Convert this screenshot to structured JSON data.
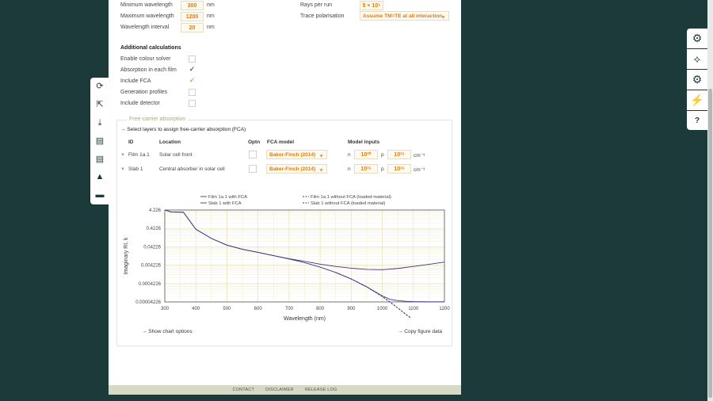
{
  "settings": {
    "min_wavelength": {
      "label": "Minimum wavelength",
      "value": "300",
      "unit": "nm"
    },
    "max_wavelength": {
      "label": "Maximum wavelength",
      "value": "1200",
      "unit": "nm"
    },
    "wavelength_interval": {
      "label": "Wavelength interval",
      "value": "20",
      "unit": "nm"
    },
    "rays_per_run": {
      "label": "Rays per run",
      "value": "5 × 10⁵"
    },
    "trace_polarisation": {
      "label": "Trace polarisation",
      "value": "Assume TM=TE at all interaction"
    }
  },
  "additional": {
    "title": "Additional calculations",
    "items": [
      {
        "label": "Enable colour solver",
        "checked": false,
        "mark": ""
      },
      {
        "label": "Absorption in each film",
        "checked": true,
        "mark": "✓"
      },
      {
        "label": "Include FCA",
        "checked": true,
        "mark": "✓"
      },
      {
        "label": "Generation profiles",
        "checked": false,
        "mark": ""
      },
      {
        "label": "Include detector",
        "checked": false,
        "mark": ""
      }
    ]
  },
  "fca": {
    "title": "Free-carrier absorption",
    "instruction": "→ Select layers to assign free-carrier absorption (FCA)",
    "headers": {
      "id": "ID",
      "location": "Location",
      "optn": "Optn",
      "model": "FCA model",
      "inputs": "Model inputs"
    },
    "rows": [
      {
        "bullet": "×",
        "id": "Film 1a.1",
        "location": "Solar cell front",
        "model": "Baker-Finch (2014)",
        "n_label": "n",
        "n_val": "10²⁰",
        "p_label": "p",
        "p_val": "10¹⁵",
        "unit": "cm⁻³"
      },
      {
        "bullet": "×",
        "id": "Slab 1",
        "location": "Central absorber in solar cell",
        "model": "Baker-Finch (2014)",
        "n_label": "n",
        "n_val": "10¹⁵",
        "p_label": "p",
        "p_val": "10¹⁶",
        "unit": "cm⁻³"
      }
    ],
    "show_chart_options": "→ Show chart options",
    "copy_figure_data": "→ Copy figure data"
  },
  "chart_data": {
    "type": "line",
    "xlabel": "Wavelength (nm)",
    "ylabel": "Imaginary RI, k",
    "x_ticks": [
      "300",
      "400",
      "500",
      "600",
      "700",
      "800",
      "900",
      "1000",
      "1100",
      "1200"
    ],
    "y_ticks": [
      "4.226",
      "0.4226",
      "0.04226",
      "0.004226",
      "0.0004226",
      "0.00004226"
    ],
    "xlim": [
      300,
      1200
    ],
    "ylim": [
      4.226e-05,
      4.226
    ],
    "y_scale": "log",
    "legend": [
      {
        "name": "Film 1a.1 with FCA",
        "style": "solid"
      },
      {
        "name": "Slab 1 with FCA",
        "style": "solid"
      },
      {
        "name": "Film 1a.1 without FCA (loaded material)",
        "style": "dashed"
      },
      {
        "name": "Slab 1 without FCA (loaded material)",
        "style": "dashed"
      }
    ],
    "series": [
      {
        "name": "Film 1a.1 with FCA",
        "style": "solid",
        "x": [
          300,
          320,
          360,
          400,
          450,
          500,
          550,
          600,
          650,
          700,
          750,
          800,
          850,
          900,
          950,
          1000,
          1050,
          1100,
          1150,
          1200
        ],
        "y": [
          4.226,
          3.3,
          3.2,
          0.38,
          0.12,
          0.052,
          0.031,
          0.021,
          0.014,
          0.0095,
          0.0068,
          0.0048,
          0.0036,
          0.0029,
          0.0025,
          0.0024,
          0.0028,
          0.0036,
          0.0047,
          0.0062
        ]
      },
      {
        "name": "Slab 1 with FCA",
        "style": "solid",
        "x": [
          300,
          320,
          360,
          400,
          450,
          500,
          550,
          600,
          650,
          700,
          750,
          800,
          850,
          900,
          950,
          1000,
          1025,
          1050,
          1075,
          1100,
          1150,
          1200
        ],
        "y": [
          4.226,
          3.3,
          3.2,
          0.38,
          0.12,
          0.052,
          0.031,
          0.021,
          0.014,
          0.0092,
          0.0058,
          0.0033,
          0.0017,
          0.00075,
          0.00028,
          9e-05,
          5.8e-05,
          5e-05,
          4.6e-05,
          4.4e-05,
          4.3e-05,
          4.3e-05
        ]
      },
      {
        "name": "Film 1a.1 without FCA (loaded material)",
        "style": "dashed",
        "x": [
          850,
          900,
          950,
          1000,
          1050,
          1080,
          1090
        ],
        "y": [
          0.0017,
          0.00075,
          0.00028,
          8.5e-05,
          2e-05,
          8e-06,
          6e-06
        ]
      },
      {
        "name": "Slab 1 without FCA (loaded material)",
        "style": "dashed",
        "x": [
          850,
          900,
          950,
          1000,
          1050,
          1075,
          1090
        ],
        "y": [
          0.0017,
          0.00075,
          0.00028,
          8.2e-05,
          2e-05,
          9e-06,
          6e-06
        ]
      }
    ],
    "colors": {
      "line": "#3d3583",
      "grid": "#e6e1b6"
    },
    "grid": true,
    "legend_placement": "top"
  },
  "footer": {
    "contact": "CONTACT",
    "disclaimer": "DISCLAIMER",
    "release_log": "RELEASE LOG"
  },
  "left_tools": [
    {
      "icon": "refresh-icon",
      "glyph": "⟳"
    },
    {
      "icon": "pointer-icon",
      "glyph": "⇱"
    },
    {
      "icon": "download-icon",
      "glyph": "⤓"
    },
    {
      "icon": "file-import-icon",
      "glyph": "▤"
    },
    {
      "icon": "file-upload-icon",
      "glyph": "▤"
    },
    {
      "icon": "graduation-cap-icon",
      "glyph": "▲"
    },
    {
      "icon": "chat-icon",
      "glyph": "▬"
    }
  ],
  "right_tools": [
    {
      "icon": "gear-icon",
      "glyph": "⚙"
    },
    {
      "icon": "light-burst-icon",
      "glyph": "⟡"
    },
    {
      "icon": "settings-icon",
      "glyph": "⚙"
    },
    {
      "icon": "lightning-icon",
      "glyph": "⚡"
    },
    {
      "icon": "help-icon",
      "glyph": "?"
    }
  ]
}
